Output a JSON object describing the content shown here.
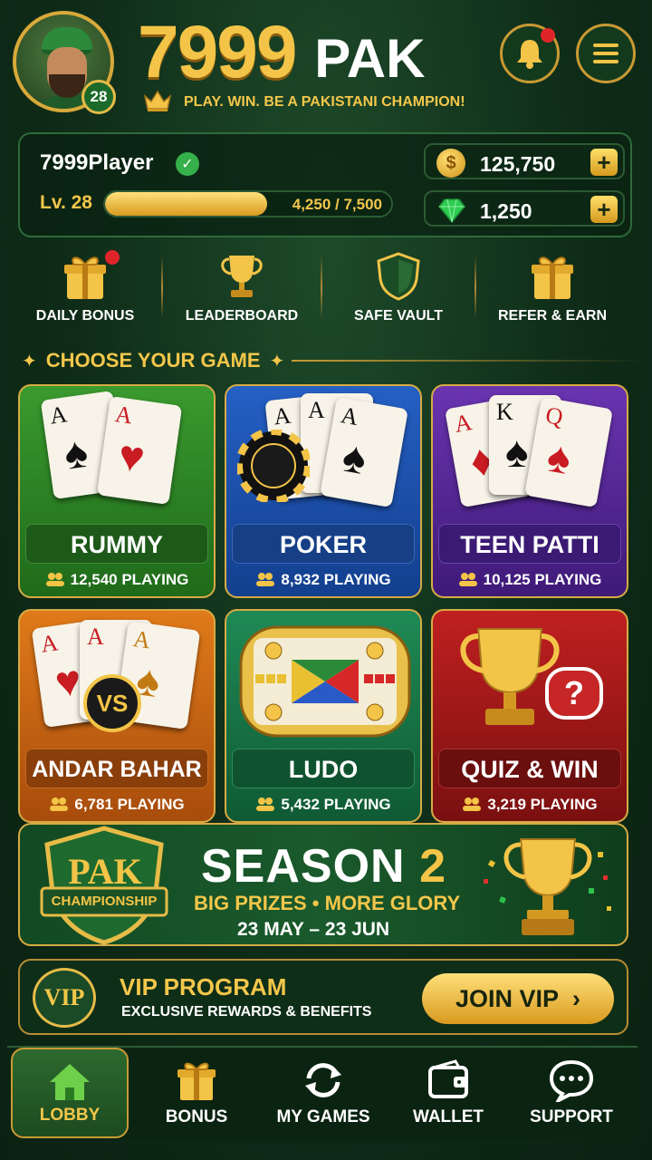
{
  "header": {
    "brand_number": "7999",
    "brand_word": "PAK",
    "tagline": "PLAY. WIN. BE A PAKISTANI CHAMPION!",
    "avatar_level": "28"
  },
  "player": {
    "name": "7999Player",
    "level_label": "Lv. 28",
    "xp_text": "4,250 / 7,500",
    "xp_progress": 0.567,
    "coins": "125,750",
    "gems": "1,250"
  },
  "quick_actions": [
    {
      "label": "DAILY BONUS",
      "icon": "gift-icon"
    },
    {
      "label": "LEADERBOARD",
      "icon": "trophy-icon"
    },
    {
      "label": "SAFE VAULT",
      "icon": "shield-icon"
    },
    {
      "label": "REFER & EARN",
      "icon": "gift-icon"
    }
  ],
  "games_section_title": "CHOOSE YOUR GAME",
  "games": [
    {
      "name": "RUMMY",
      "playing": "12,540 PLAYING"
    },
    {
      "name": "POKER",
      "playing": "8,932 PLAYING"
    },
    {
      "name": "TEEN PATTI",
      "playing": "10,125 PLAYING"
    },
    {
      "name": "ANDAR BAHAR",
      "playing": "6,781 PLAYING"
    },
    {
      "name": "LUDO",
      "playing": "5,432 PLAYING"
    },
    {
      "name": "QUIZ & WIN",
      "playing": "3,219 PLAYING"
    }
  ],
  "season": {
    "shield_top": "PAK",
    "shield_bottom": "CHAMPIONSHIP",
    "title_word": "SEASON",
    "title_num": "2",
    "subtitle": "BIG PRIZES • MORE GLORY",
    "dates": "23 MAY – 23 JUN"
  },
  "vip": {
    "badge": "VIP",
    "title": "VIP PROGRAM",
    "subtitle": "EXCLUSIVE REWARDS & BENEFITS",
    "button": "JOIN VIP"
  },
  "nav": [
    {
      "label": "LOBBY",
      "icon": "home-icon",
      "active": true
    },
    {
      "label": "BONUS",
      "icon": "gift-icon"
    },
    {
      "label": "MY GAMES",
      "icon": "refresh-icon"
    },
    {
      "label": "WALLET",
      "icon": "wallet-icon"
    },
    {
      "label": "SUPPORT",
      "icon": "chat-icon"
    }
  ],
  "colors": {
    "gold": "#f3c64a",
    "green_bg": "#0f2c18",
    "rummy": "#2f8a2a",
    "poker": "#1e4ea8",
    "teenpatti": "#5a2a9a",
    "andar": "#d06a14",
    "ludo": "#1a7a4a",
    "quiz": "#a51818"
  }
}
